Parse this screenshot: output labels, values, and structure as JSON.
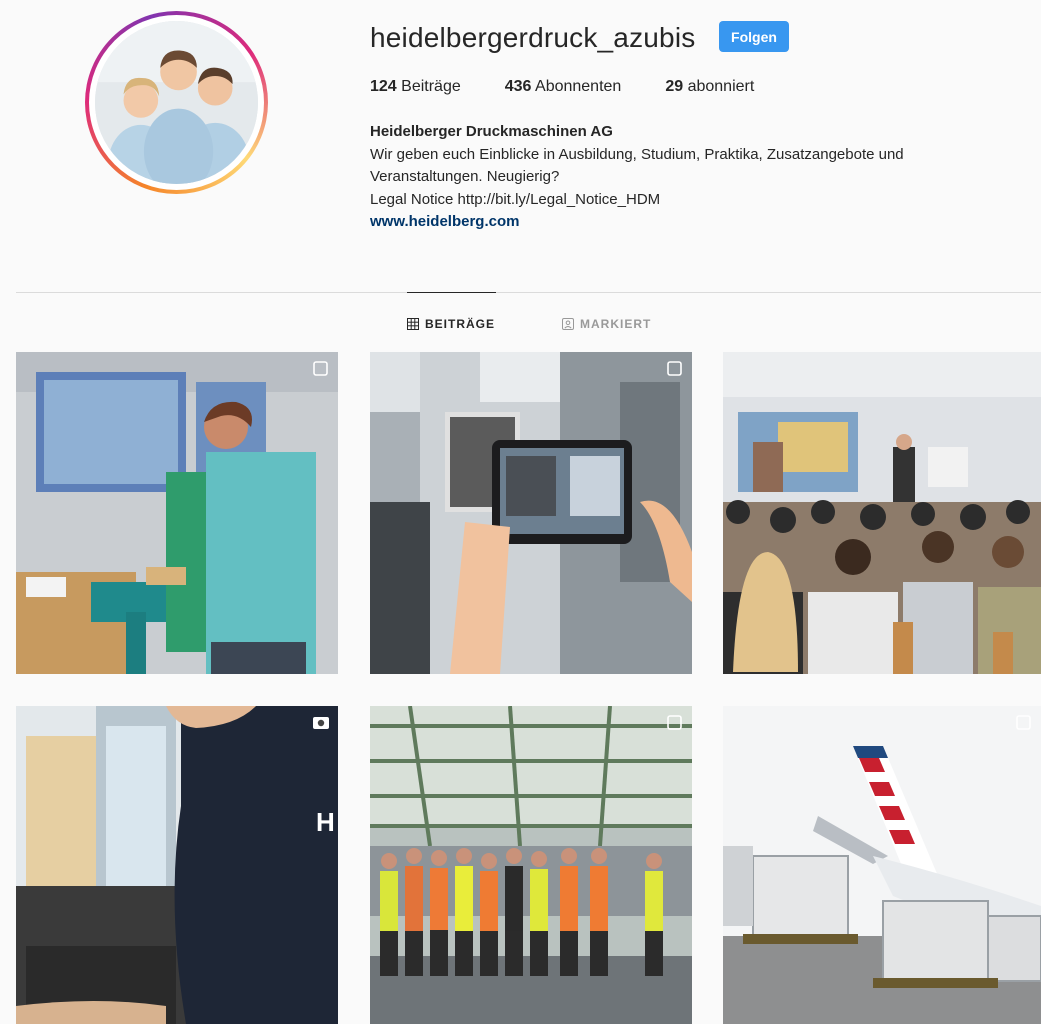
{
  "profile": {
    "username": "heidelbergerdruck_azubis",
    "follow_label": "Folgen",
    "stats": {
      "posts_count": "124",
      "posts_label": "Beiträge",
      "followers_count": "436",
      "followers_label": "Abonnenten",
      "following_count": "29",
      "following_label": "abonniert"
    },
    "full_name": "Heidelberger Druckmaschinen AG",
    "bio_line1": "Wir geben euch Einblicke in Ausbildung, Studium, Praktika, Zusatzangebote und",
    "bio_line2": "Veranstaltungen. Neugierig?",
    "bio_line3": "Legal Notice http://bit.ly/Legal_Notice_HDM",
    "website": "www.heidelberg.com"
  },
  "tabs": {
    "posts_label": "BEITRÄGE",
    "tagged_label": "MARKIERT"
  },
  "posts": [
    {
      "icon": "multi-image-icon"
    },
    {
      "icon": "multi-image-icon"
    },
    {
      "icon": ""
    },
    {
      "icon": "video-icon"
    },
    {
      "icon": "multi-image-icon"
    },
    {
      "icon": "multi-image-icon"
    }
  ],
  "colors": {
    "accent": "#3897f0",
    "link": "#003569",
    "background": "#fafafa"
  }
}
